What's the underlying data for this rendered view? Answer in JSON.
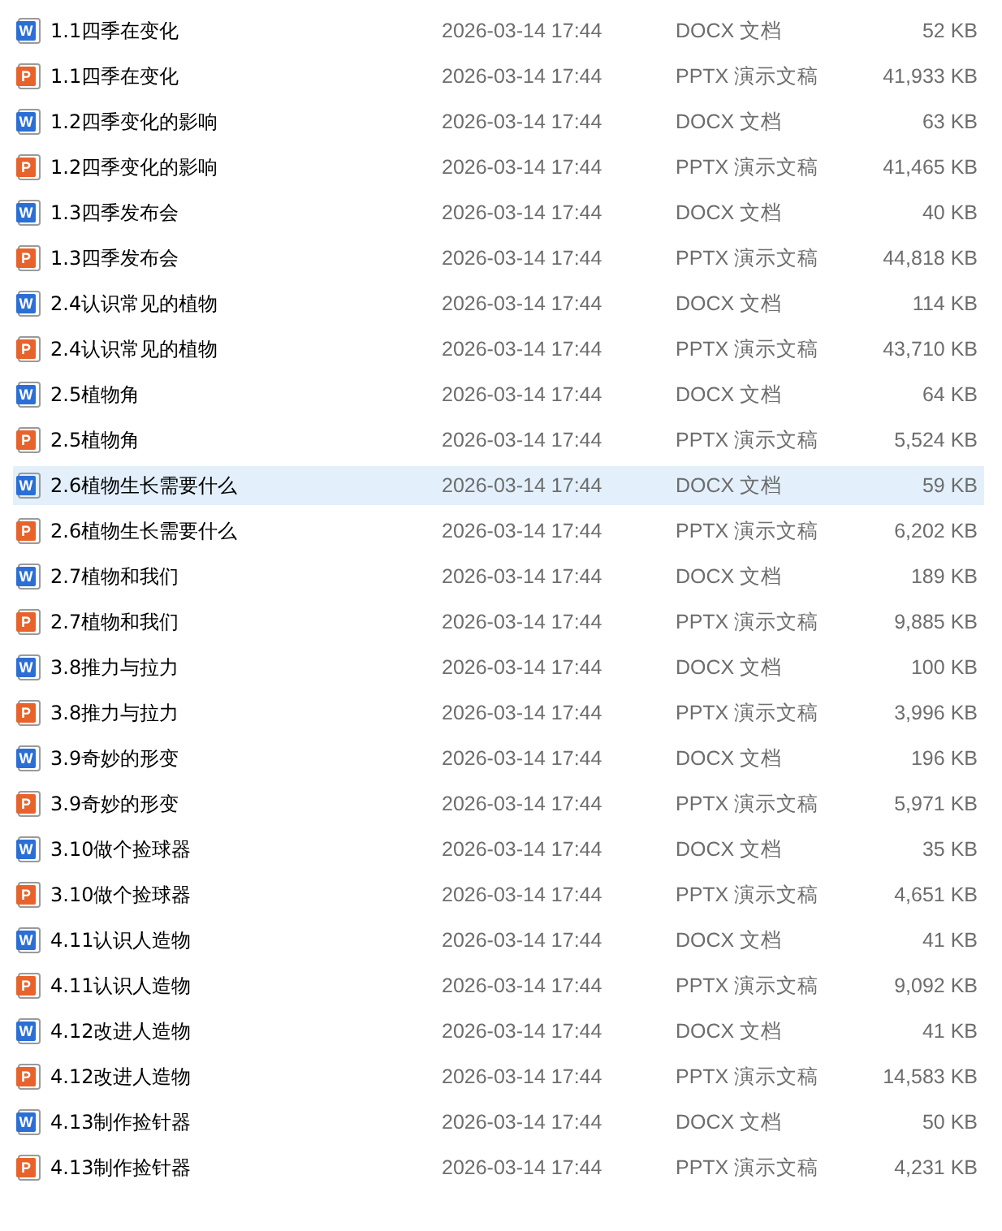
{
  "files": [
    {
      "name": "1.1四季在变化",
      "kind": "docx",
      "badge": "W",
      "modified": "2026-03-14 17:44",
      "type": "DOCX 文档",
      "size": "52 KB",
      "selected": false
    },
    {
      "name": "1.1四季在变化",
      "kind": "pptx",
      "badge": "P",
      "modified": "2026-03-14 17:44",
      "type": "PPTX 演示文稿",
      "size": "41,933 KB",
      "selected": false
    },
    {
      "name": "1.2四季变化的影响",
      "kind": "docx",
      "badge": "W",
      "modified": "2026-03-14 17:44",
      "type": "DOCX 文档",
      "size": "63 KB",
      "selected": false
    },
    {
      "name": "1.2四季变化的影响",
      "kind": "pptx",
      "badge": "P",
      "modified": "2026-03-14 17:44",
      "type": "PPTX 演示文稿",
      "size": "41,465 KB",
      "selected": false
    },
    {
      "name": "1.3四季发布会",
      "kind": "docx",
      "badge": "W",
      "modified": "2026-03-14 17:44",
      "type": "DOCX 文档",
      "size": "40 KB",
      "selected": false
    },
    {
      "name": "1.3四季发布会",
      "kind": "pptx",
      "badge": "P",
      "modified": "2026-03-14 17:44",
      "type": "PPTX 演示文稿",
      "size": "44,818 KB",
      "selected": false
    },
    {
      "name": "2.4认识常见的植物",
      "kind": "docx",
      "badge": "W",
      "modified": "2026-03-14 17:44",
      "type": "DOCX 文档",
      "size": "114 KB",
      "selected": false
    },
    {
      "name": "2.4认识常见的植物",
      "kind": "pptx",
      "badge": "P",
      "modified": "2026-03-14 17:44",
      "type": "PPTX 演示文稿",
      "size": "43,710 KB",
      "selected": false
    },
    {
      "name": "2.5植物角",
      "kind": "docx",
      "badge": "W",
      "modified": "2026-03-14 17:44",
      "type": "DOCX 文档",
      "size": "64 KB",
      "selected": false
    },
    {
      "name": "2.5植物角",
      "kind": "pptx",
      "badge": "P",
      "modified": "2026-03-14 17:44",
      "type": "PPTX 演示文稿",
      "size": "5,524 KB",
      "selected": false
    },
    {
      "name": "2.6植物生长需要什么",
      "kind": "docx",
      "badge": "W",
      "modified": "2026-03-14 17:44",
      "type": "DOCX 文档",
      "size": "59 KB",
      "selected": true
    },
    {
      "name": "2.6植物生长需要什么",
      "kind": "pptx",
      "badge": "P",
      "modified": "2026-03-14 17:44",
      "type": "PPTX 演示文稿",
      "size": "6,202 KB",
      "selected": false
    },
    {
      "name": "2.7植物和我们",
      "kind": "docx",
      "badge": "W",
      "modified": "2026-03-14 17:44",
      "type": "DOCX 文档",
      "size": "189 KB",
      "selected": false
    },
    {
      "name": "2.7植物和我们",
      "kind": "pptx",
      "badge": "P",
      "modified": "2026-03-14 17:44",
      "type": "PPTX 演示文稿",
      "size": "9,885 KB",
      "selected": false
    },
    {
      "name": "3.8推力与拉力",
      "kind": "docx",
      "badge": "W",
      "modified": "2026-03-14 17:44",
      "type": "DOCX 文档",
      "size": "100 KB",
      "selected": false
    },
    {
      "name": "3.8推力与拉力",
      "kind": "pptx",
      "badge": "P",
      "modified": "2026-03-14 17:44",
      "type": "PPTX 演示文稿",
      "size": "3,996 KB",
      "selected": false
    },
    {
      "name": "3.9奇妙的形变",
      "kind": "docx",
      "badge": "W",
      "modified": "2026-03-14 17:44",
      "type": "DOCX 文档",
      "size": "196 KB",
      "selected": false
    },
    {
      "name": "3.9奇妙的形变",
      "kind": "pptx",
      "badge": "P",
      "modified": "2026-03-14 17:44",
      "type": "PPTX 演示文稿",
      "size": "5,971 KB",
      "selected": false
    },
    {
      "name": "3.10做个捡球器",
      "kind": "docx",
      "badge": "W",
      "modified": "2026-03-14 17:44",
      "type": "DOCX 文档",
      "size": "35 KB",
      "selected": false
    },
    {
      "name": "3.10做个捡球器",
      "kind": "pptx",
      "badge": "P",
      "modified": "2026-03-14 17:44",
      "type": "PPTX 演示文稿",
      "size": "4,651 KB",
      "selected": false
    },
    {
      "name": "4.11认识人造物",
      "kind": "docx",
      "badge": "W",
      "modified": "2026-03-14 17:44",
      "type": "DOCX 文档",
      "size": "41 KB",
      "selected": false
    },
    {
      "name": "4.11认识人造物",
      "kind": "pptx",
      "badge": "P",
      "modified": "2026-03-14 17:44",
      "type": "PPTX 演示文稿",
      "size": "9,092 KB",
      "selected": false
    },
    {
      "name": "4.12改进人造物",
      "kind": "docx",
      "badge": "W",
      "modified": "2026-03-14 17:44",
      "type": "DOCX 文档",
      "size": "41 KB",
      "selected": false
    },
    {
      "name": "4.12改进人造物",
      "kind": "pptx",
      "badge": "P",
      "modified": "2026-03-14 17:44",
      "type": "PPTX 演示文稿",
      "size": "14,583 KB",
      "selected": false
    },
    {
      "name": "4.13制作捡针器",
      "kind": "docx",
      "badge": "W",
      "modified": "2026-03-14 17:44",
      "type": "DOCX 文档",
      "size": "50 KB",
      "selected": false
    },
    {
      "name": "4.13制作捡针器",
      "kind": "pptx",
      "badge": "P",
      "modified": "2026-03-14 17:44",
      "type": "PPTX 演示文稿",
      "size": "4,231 KB",
      "selected": false
    }
  ]
}
